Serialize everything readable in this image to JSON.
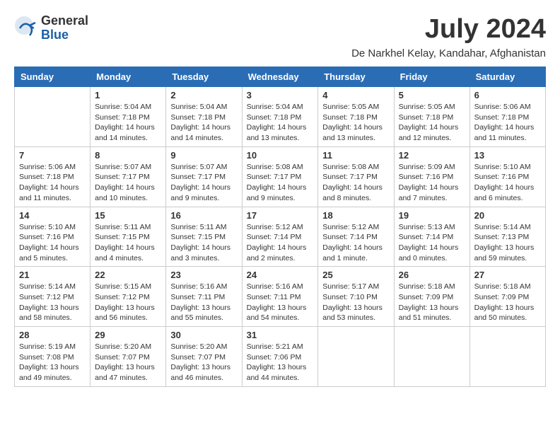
{
  "header": {
    "logo_general": "General",
    "logo_blue": "Blue",
    "month_year": "July 2024",
    "location": "De Narkhel Kelay, Kandahar, Afghanistan"
  },
  "columns": [
    "Sunday",
    "Monday",
    "Tuesday",
    "Wednesday",
    "Thursday",
    "Friday",
    "Saturday"
  ],
  "weeks": [
    [
      {
        "day": "",
        "detail": ""
      },
      {
        "day": "1",
        "detail": "Sunrise: 5:04 AM\nSunset: 7:18 PM\nDaylight: 14 hours\nand 14 minutes."
      },
      {
        "day": "2",
        "detail": "Sunrise: 5:04 AM\nSunset: 7:18 PM\nDaylight: 14 hours\nand 14 minutes."
      },
      {
        "day": "3",
        "detail": "Sunrise: 5:04 AM\nSunset: 7:18 PM\nDaylight: 14 hours\nand 13 minutes."
      },
      {
        "day": "4",
        "detail": "Sunrise: 5:05 AM\nSunset: 7:18 PM\nDaylight: 14 hours\nand 13 minutes."
      },
      {
        "day": "5",
        "detail": "Sunrise: 5:05 AM\nSunset: 7:18 PM\nDaylight: 14 hours\nand 12 minutes."
      },
      {
        "day": "6",
        "detail": "Sunrise: 5:06 AM\nSunset: 7:18 PM\nDaylight: 14 hours\nand 11 minutes."
      }
    ],
    [
      {
        "day": "7",
        "detail": "Sunrise: 5:06 AM\nSunset: 7:18 PM\nDaylight: 14 hours\nand 11 minutes."
      },
      {
        "day": "8",
        "detail": "Sunrise: 5:07 AM\nSunset: 7:17 PM\nDaylight: 14 hours\nand 10 minutes."
      },
      {
        "day": "9",
        "detail": "Sunrise: 5:07 AM\nSunset: 7:17 PM\nDaylight: 14 hours\nand 9 minutes."
      },
      {
        "day": "10",
        "detail": "Sunrise: 5:08 AM\nSunset: 7:17 PM\nDaylight: 14 hours\nand 9 minutes."
      },
      {
        "day": "11",
        "detail": "Sunrise: 5:08 AM\nSunset: 7:17 PM\nDaylight: 14 hours\nand 8 minutes."
      },
      {
        "day": "12",
        "detail": "Sunrise: 5:09 AM\nSunset: 7:16 PM\nDaylight: 14 hours\nand 7 minutes."
      },
      {
        "day": "13",
        "detail": "Sunrise: 5:10 AM\nSunset: 7:16 PM\nDaylight: 14 hours\nand 6 minutes."
      }
    ],
    [
      {
        "day": "14",
        "detail": "Sunrise: 5:10 AM\nSunset: 7:16 PM\nDaylight: 14 hours\nand 5 minutes."
      },
      {
        "day": "15",
        "detail": "Sunrise: 5:11 AM\nSunset: 7:15 PM\nDaylight: 14 hours\nand 4 minutes."
      },
      {
        "day": "16",
        "detail": "Sunrise: 5:11 AM\nSunset: 7:15 PM\nDaylight: 14 hours\nand 3 minutes."
      },
      {
        "day": "17",
        "detail": "Sunrise: 5:12 AM\nSunset: 7:14 PM\nDaylight: 14 hours\nand 2 minutes."
      },
      {
        "day": "18",
        "detail": "Sunrise: 5:12 AM\nSunset: 7:14 PM\nDaylight: 14 hours\nand 1 minute."
      },
      {
        "day": "19",
        "detail": "Sunrise: 5:13 AM\nSunset: 7:14 PM\nDaylight: 14 hours\nand 0 minutes."
      },
      {
        "day": "20",
        "detail": "Sunrise: 5:14 AM\nSunset: 7:13 PM\nDaylight: 13 hours\nand 59 minutes."
      }
    ],
    [
      {
        "day": "21",
        "detail": "Sunrise: 5:14 AM\nSunset: 7:12 PM\nDaylight: 13 hours\nand 58 minutes."
      },
      {
        "day": "22",
        "detail": "Sunrise: 5:15 AM\nSunset: 7:12 PM\nDaylight: 13 hours\nand 56 minutes."
      },
      {
        "day": "23",
        "detail": "Sunrise: 5:16 AM\nSunset: 7:11 PM\nDaylight: 13 hours\nand 55 minutes."
      },
      {
        "day": "24",
        "detail": "Sunrise: 5:16 AM\nSunset: 7:11 PM\nDaylight: 13 hours\nand 54 minutes."
      },
      {
        "day": "25",
        "detail": "Sunrise: 5:17 AM\nSunset: 7:10 PM\nDaylight: 13 hours\nand 53 minutes."
      },
      {
        "day": "26",
        "detail": "Sunrise: 5:18 AM\nSunset: 7:09 PM\nDaylight: 13 hours\nand 51 minutes."
      },
      {
        "day": "27",
        "detail": "Sunrise: 5:18 AM\nSunset: 7:09 PM\nDaylight: 13 hours\nand 50 minutes."
      }
    ],
    [
      {
        "day": "28",
        "detail": "Sunrise: 5:19 AM\nSunset: 7:08 PM\nDaylight: 13 hours\nand 49 minutes."
      },
      {
        "day": "29",
        "detail": "Sunrise: 5:20 AM\nSunset: 7:07 PM\nDaylight: 13 hours\nand 47 minutes."
      },
      {
        "day": "30",
        "detail": "Sunrise: 5:20 AM\nSunset: 7:07 PM\nDaylight: 13 hours\nand 46 minutes."
      },
      {
        "day": "31",
        "detail": "Sunrise: 5:21 AM\nSunset: 7:06 PM\nDaylight: 13 hours\nand 44 minutes."
      },
      {
        "day": "",
        "detail": ""
      },
      {
        "day": "",
        "detail": ""
      },
      {
        "day": "",
        "detail": ""
      }
    ]
  ]
}
